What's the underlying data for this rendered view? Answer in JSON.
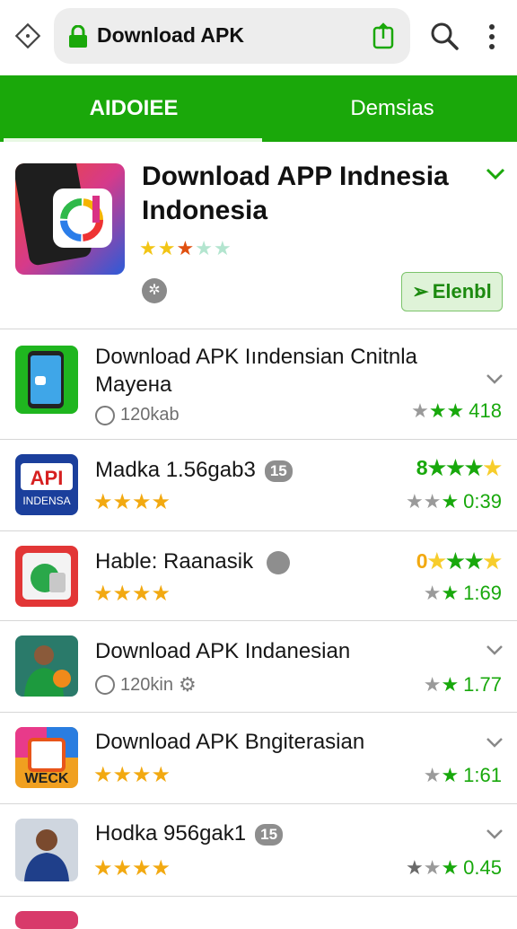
{
  "browser": {
    "url_title": "Download APK"
  },
  "tabs": [
    {
      "label": "AIDOIEE"
    },
    {
      "label": "Demsias"
    }
  ],
  "featured": {
    "title": "Download APP Indnesia Indonesia",
    "button_label": "Elenbl",
    "badge": "✲"
  },
  "rows": [
    {
      "title": "Download APK Iındensian Cnitnla",
      "title2": "Mayeнa",
      "sub": "120kab",
      "right_value": "418"
    },
    {
      "title": "Madka 1.56gab3",
      "badge": "15",
      "top_score": "8",
      "right_value": "0:39"
    },
    {
      "title": "Hable: Raanasik",
      "top_score": "0",
      "right_value": "1:69"
    },
    {
      "title": "Download APK Indanesian",
      "sub": "120kin",
      "right_value": "1.77"
    },
    {
      "title": "Download APK Bngiterasian",
      "right_value": "1:61"
    },
    {
      "title": "Hodka 956gak1",
      "badge": "15",
      "right_value": "0.45"
    }
  ],
  "icon_labels": {
    "api": "API",
    "api_sub": "INDENSA",
    "weck": "WECK"
  },
  "colors": {
    "accent_green": "#1aa80a",
    "star_yellow": "#f2a911"
  }
}
